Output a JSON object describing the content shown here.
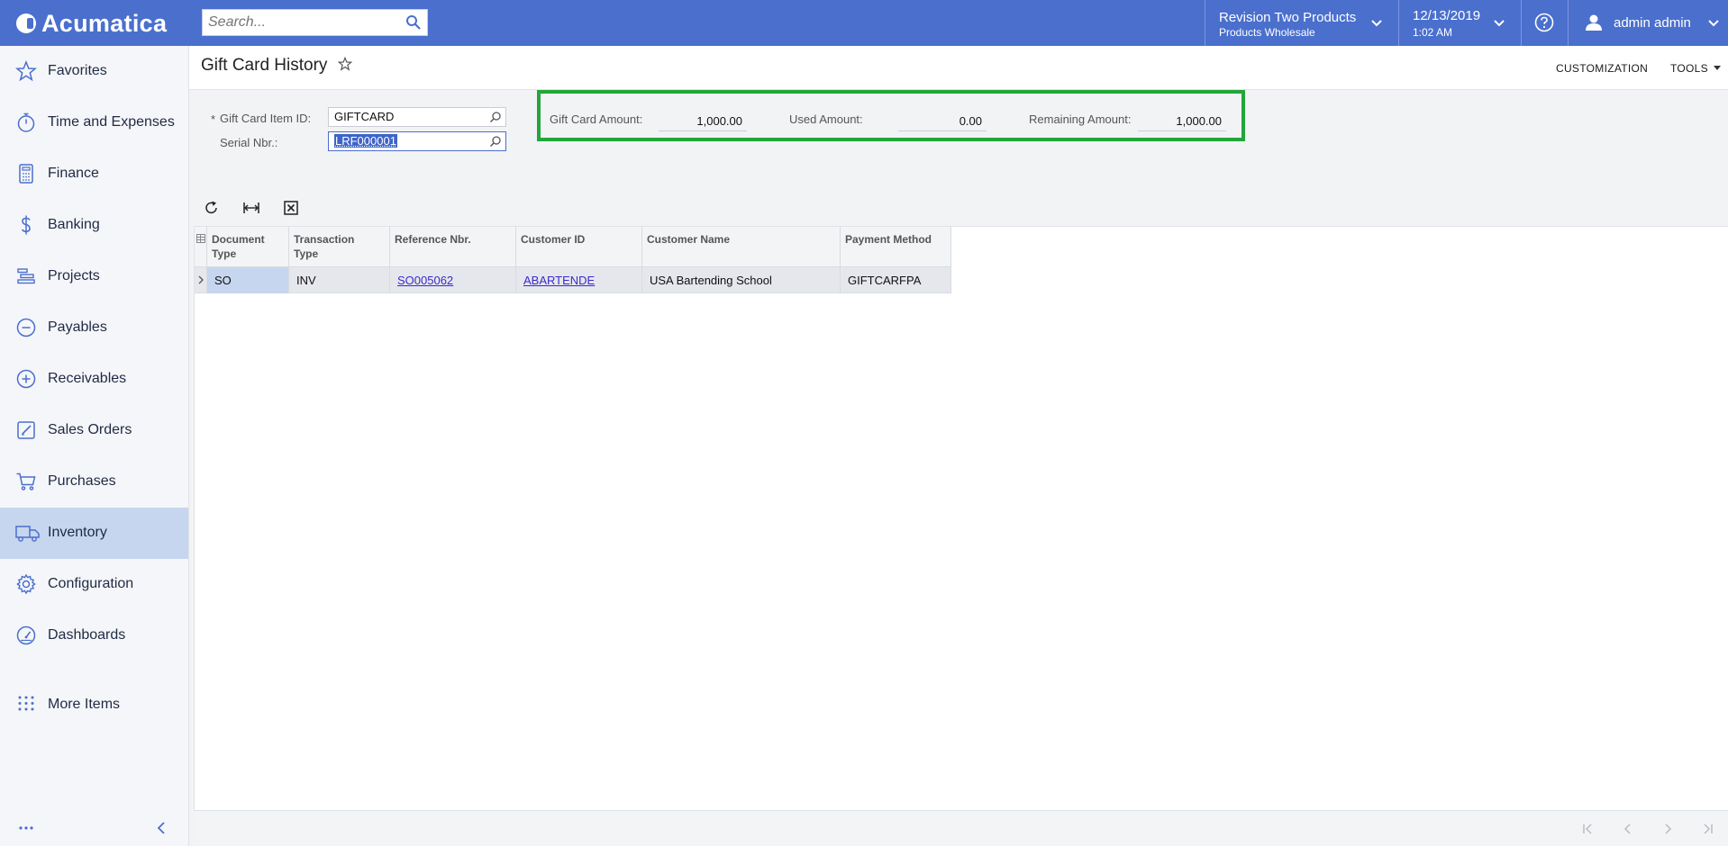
{
  "topbar": {
    "brand": "Acumatica",
    "search_placeholder": "Search...",
    "branch_line1": "Revision Two Products",
    "branch_line2": "Products Wholesale",
    "date": "12/13/2019",
    "time": "1:02 AM",
    "user": "admin admin",
    "accent": "#4a6fcd"
  },
  "sidebar": {
    "items": [
      {
        "label": "Favorites",
        "icon": "star-icon"
      },
      {
        "label": "Time and Expenses",
        "icon": "stopwatch-icon"
      },
      {
        "label": "Finance",
        "icon": "calculator-icon"
      },
      {
        "label": "Banking",
        "icon": "dollar-icon"
      },
      {
        "label": "Projects",
        "icon": "projects-icon"
      },
      {
        "label": "Payables",
        "icon": "minus-circle-icon"
      },
      {
        "label": "Receivables",
        "icon": "plus-circle-icon"
      },
      {
        "label": "Sales Orders",
        "icon": "edit-icon"
      },
      {
        "label": "Purchases",
        "icon": "cart-icon"
      },
      {
        "label": "Inventory",
        "icon": "truck-icon"
      },
      {
        "label": "Configuration",
        "icon": "gear-icon"
      },
      {
        "label": "Dashboards",
        "icon": "gauge-icon"
      },
      {
        "label": "More Items",
        "icon": "grid-dots-icon"
      }
    ],
    "active": "Inventory"
  },
  "page": {
    "title": "Gift Card History",
    "customization": "CUSTOMIZATION",
    "tools": "TOOLS"
  },
  "form": {
    "item_label": "Gift Card Item ID:",
    "item_value": "GIFTCARD",
    "serial_label": "Serial Nbr.:",
    "serial_value": "LRF000001",
    "required_mark": "*"
  },
  "summary": {
    "gift_label": "Gift Card Amount:",
    "gift_value": "1,000.00",
    "used_label": "Used Amount:",
    "used_value": "0.00",
    "remaining_label": "Remaining Amount:",
    "remaining_value": "1,000.00",
    "highlight_color": "#22a63a"
  },
  "grid": {
    "headers": [
      "Document Type",
      "Transaction Type",
      "Reference Nbr.",
      "Customer ID",
      "Customer Name",
      "Payment Method"
    ],
    "header_lines": [
      [
        "Document",
        "Type"
      ],
      [
        "Transaction",
        "Type"
      ],
      [
        "Reference Nbr.",
        ""
      ],
      [
        "Customer ID",
        ""
      ],
      [
        "Customer Name",
        ""
      ],
      [
        "Payment Method",
        ""
      ]
    ],
    "rows": [
      {
        "doc_type": "SO",
        "tran_type": "INV",
        "ref_nbr": "SO005062",
        "customer_id": "ABARTENDE",
        "customer_name": "USA Bartending School",
        "payment_method": "GIFTCARFPA"
      }
    ]
  }
}
